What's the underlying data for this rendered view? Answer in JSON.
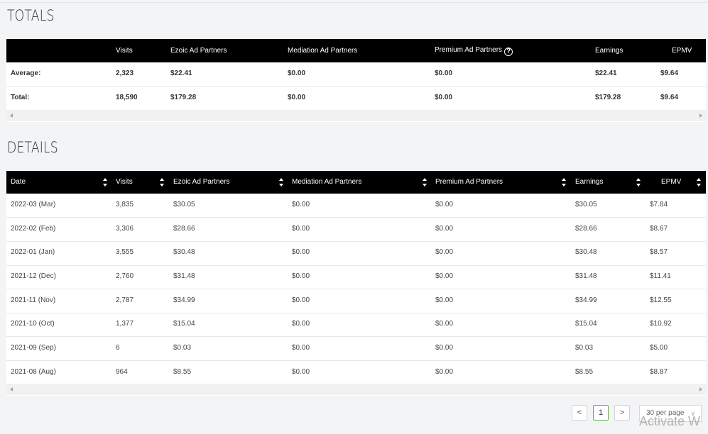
{
  "totals": {
    "title": "TOTALS",
    "headers": [
      "Visits",
      "Ezoic Ad Partners",
      "Mediation Ad Partners",
      "Premium Ad Partners",
      "Earnings",
      "EPMV"
    ],
    "help_icon_glyph": "?",
    "rows": [
      {
        "label": "Average:",
        "visits": "2,323",
        "ezoic": "$22.41",
        "mediation": "$0.00",
        "premium": "$0.00",
        "earnings": "$22.41",
        "epmv": "$9.64"
      },
      {
        "label": "Total:",
        "visits": "18,590",
        "ezoic": "$179.28",
        "mediation": "$0.00",
        "premium": "$0.00",
        "earnings": "$179.28",
        "epmv": "$9.64"
      }
    ]
  },
  "details": {
    "title": "DETAILS",
    "headers": [
      "Date",
      "Visits",
      "Ezoic Ad Partners",
      "Mediation Ad Partners",
      "Premium Ad Partners",
      "Earnings",
      "EPMV"
    ],
    "rows": [
      {
        "date": "2022-03 (Mar)",
        "visits": "3,835",
        "ezoic": "$30.05",
        "mediation": "$0.00",
        "premium": "$0.00",
        "earnings": "$30.05",
        "epmv": "$7.84"
      },
      {
        "date": "2022-02 (Feb)",
        "visits": "3,306",
        "ezoic": "$28.66",
        "mediation": "$0.00",
        "premium": "$0.00",
        "earnings": "$28.66",
        "epmv": "$8.67"
      },
      {
        "date": "2022-01 (Jan)",
        "visits": "3,555",
        "ezoic": "$30.48",
        "mediation": "$0.00",
        "premium": "$0.00",
        "earnings": "$30.48",
        "epmv": "$8.57"
      },
      {
        "date": "2021-12 (Dec)",
        "visits": "2,760",
        "ezoic": "$31.48",
        "mediation": "$0.00",
        "premium": "$0.00",
        "earnings": "$31.48",
        "epmv": "$11.41"
      },
      {
        "date": "2021-11 (Nov)",
        "visits": "2,787",
        "ezoic": "$34.99",
        "mediation": "$0.00",
        "premium": "$0.00",
        "earnings": "$34.99",
        "epmv": "$12.55"
      },
      {
        "date": "2021-10 (Oct)",
        "visits": "1,377",
        "ezoic": "$15.04",
        "mediation": "$0.00",
        "premium": "$0.00",
        "earnings": "$15.04",
        "epmv": "$10.92"
      },
      {
        "date": "2021-09 (Sep)",
        "visits": "6",
        "ezoic": "$0.03",
        "mediation": "$0.00",
        "premium": "$0.00",
        "earnings": "$0.03",
        "epmv": "$5.00"
      },
      {
        "date": "2021-08 (Aug)",
        "visits": "964",
        "ezoic": "$8.55",
        "mediation": "$0.00",
        "premium": "$0.00",
        "earnings": "$8.55",
        "epmv": "$8.87"
      }
    ]
  },
  "pagination": {
    "prev_glyph": "<",
    "current_page": "1",
    "next_glyph": ">",
    "per_page": "30 per page",
    "per_page_chevron": "∨"
  },
  "watermark": "Activate W"
}
